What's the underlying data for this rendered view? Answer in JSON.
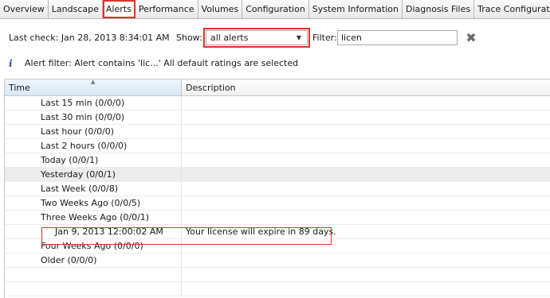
{
  "tabs": [
    {
      "label": "Overview",
      "active": false
    },
    {
      "label": "Landscape",
      "active": false
    },
    {
      "label": "Alerts",
      "active": true
    },
    {
      "label": "Performance",
      "active": false
    },
    {
      "label": "Volumes",
      "active": false
    },
    {
      "label": "Configuration",
      "active": false
    },
    {
      "label": "System Information",
      "active": false
    },
    {
      "label": "Diagnosis Files",
      "active": false
    },
    {
      "label": "Trace Configuration",
      "active": false
    }
  ],
  "toolbar": {
    "last_check": "Last check: Jan 28, 2013 8:34:01 AM",
    "show_label": "Show:",
    "show_value": "all alerts",
    "filter_label": "Filter:",
    "filter_value": "licen"
  },
  "info": {
    "text": "Alert filter: Alert contains 'lic...' All default ratings are selected"
  },
  "table": {
    "columns": {
      "time": "Time",
      "description": "Description"
    },
    "rows": [
      {
        "time": "Last 15 min (0/0/0)",
        "description": ""
      },
      {
        "time": "Last 30 min (0/0/0)",
        "description": ""
      },
      {
        "time": "Last hour (0/0/0)",
        "description": ""
      },
      {
        "time": "Last 2 hours (0/0/0)",
        "description": ""
      },
      {
        "time": "Today (0/0/1)",
        "description": ""
      },
      {
        "time": "Yesterday (0/0/1)",
        "description": ""
      },
      {
        "time": "Last Week (0/0/8)",
        "description": ""
      },
      {
        "time": "Two Weeks Ago (0/0/5)",
        "description": ""
      },
      {
        "time": "Three Weeks Ago (0/0/1)",
        "description": ""
      },
      {
        "time": "Jan 9, 2013 12:00:02 AM",
        "description": "Your license will expire in 89 days."
      },
      {
        "time": "Four Weeks Ago (0/0/0)",
        "description": ""
      },
      {
        "time": "Older (0/0/0)",
        "description": ""
      }
    ]
  }
}
